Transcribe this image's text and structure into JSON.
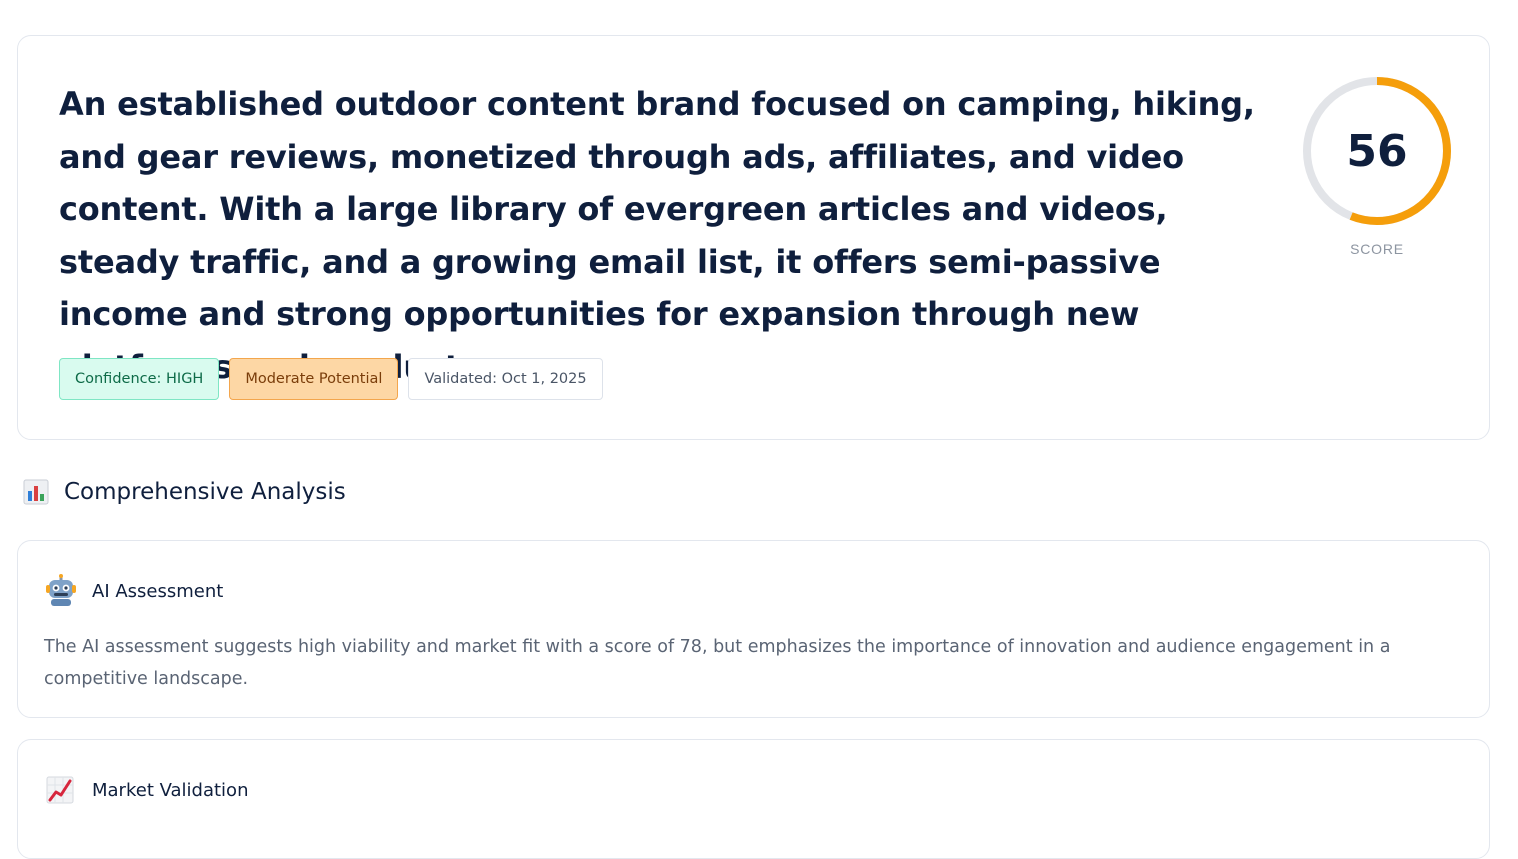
{
  "summary": {
    "description": "An established outdoor content brand focused on camping, hiking, and gear reviews, monetized through ads, affiliates, and video content. With a large library of evergreen articles and videos, steady traffic, and a growing email list, it offers semi-passive income and strong opportunities for expansion through new platforms and products.",
    "badges": {
      "confidence": "Confidence: HIGH",
      "potential": "Moderate Potential",
      "validated": "Validated: Oct 1, 2025"
    },
    "score": {
      "value": "56",
      "fraction": 0.56,
      "label": "SCORE",
      "ring_color": "#f59e0b",
      "track_color": "#e2e4e8"
    }
  },
  "analysis": {
    "title": "Comprehensive Analysis",
    "title_icon": "bar-chart-icon",
    "cards": [
      {
        "icon": "robot-icon",
        "title": "AI Assessment",
        "body": "The AI assessment suggests high viability and market fit with a score of 78, but emphasizes the importance of innovation and audience engagement in a competitive landscape."
      },
      {
        "icon": "trending-up-chart-icon",
        "title": "Market Validation",
        "body": ""
      }
    ]
  }
}
